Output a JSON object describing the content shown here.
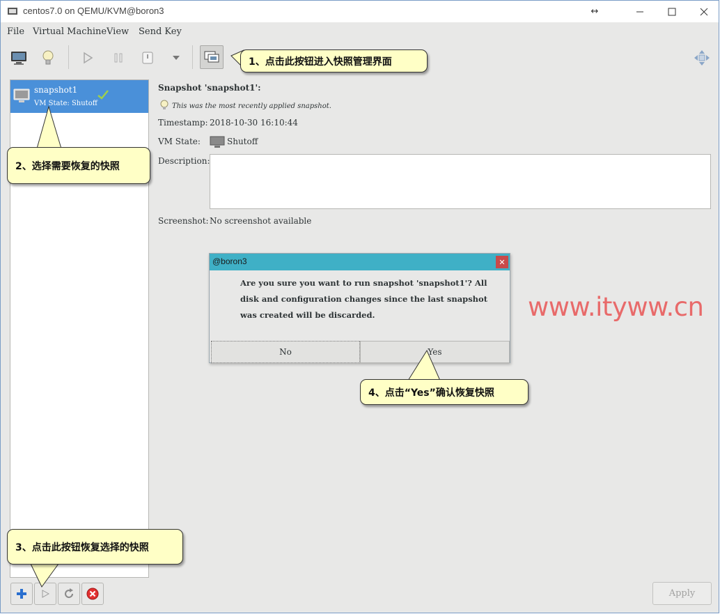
{
  "window": {
    "title": "centos7.0 on QEMU/KVM@boron3"
  },
  "menu": {
    "items": [
      "File",
      "Virtual Machine",
      "View",
      "Send Key"
    ]
  },
  "snapshot_list": {
    "items": [
      {
        "name": "snapshot1",
        "state": "VM State: Shutoff",
        "selected": true,
        "current": true
      }
    ]
  },
  "details": {
    "title": "Snapshot 'snapshot1':",
    "hint": "This was the most recently applied snapshot.",
    "timestamp_label": "Timestamp:",
    "timestamp_value": "2018-10-30 16:10:44",
    "vmstate_label": "VM State:",
    "vmstate_value": "Shutoff",
    "description_label": "Description:",
    "description_value": "",
    "screenshot_label": "Screenshot:",
    "screenshot_value": "No screenshot available",
    "apply_label": "Apply"
  },
  "dialog": {
    "title": "@boron3",
    "message": "Are you sure you want to run snapshot 'snapshot1'? All disk and configuration changes since the last snapshot was created will be discarded.",
    "no_label": "No",
    "yes_label": "Yes"
  },
  "callouts": {
    "step1": "1、点击此按钮进入快照管理界面",
    "step2": "2、选择需要恢复的快照",
    "step3": "3、点击此按钮恢复选择的快照",
    "step4": "4、点击“Yes”确认恢复快照"
  },
  "watermark": "www.ityww.cn",
  "colors": {
    "selection": "#4a90d9",
    "dialog_titlebar": "#3fb0c6",
    "callout_fill": "#ffffc6",
    "watermark": "#e86a6a"
  }
}
